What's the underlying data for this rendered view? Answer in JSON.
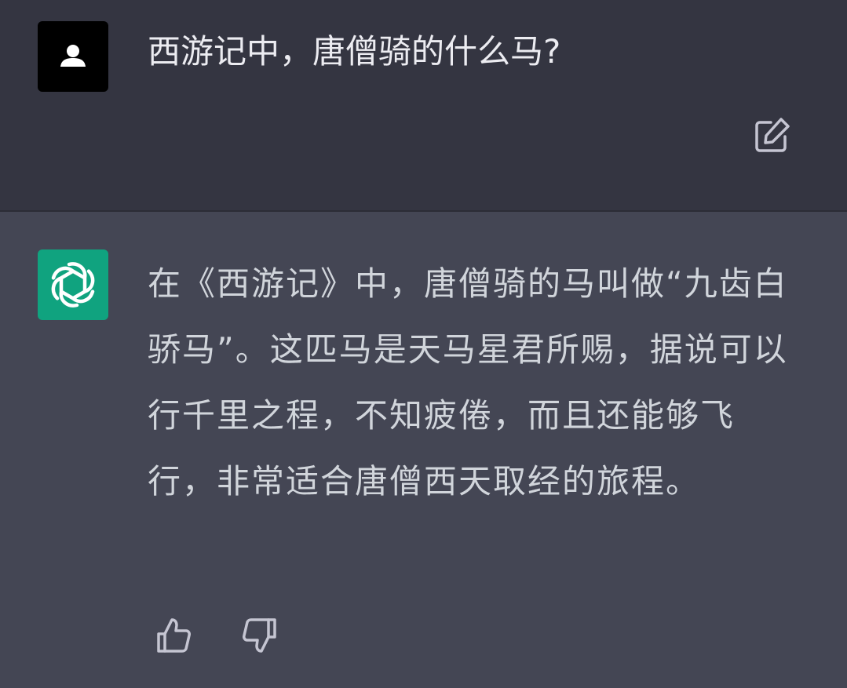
{
  "user_message": {
    "text": "西游记中，唐僧骑的什么马?"
  },
  "assistant_message": {
    "text": "在《西游记》中，唐僧骑的马叫做“九齿白骄马”。这匹马是天马星君所赐，据说可以行千里之程，不知疲倦，而且还能够飞行，非常适合唐僧西天取经的旅程。"
  },
  "icons": {
    "user_avatar": "user-silhouette-icon",
    "assistant_avatar": "openai-logo-icon",
    "edit": "edit-pencil-icon",
    "thumbs_up": "thumbs-up-icon",
    "thumbs_down": "thumbs-down-icon"
  },
  "colors": {
    "user_bg": "#343541",
    "assistant_bg": "#444654",
    "assistant_avatar_bg": "#10a37f",
    "user_avatar_bg": "#000000",
    "text": "#ececf1",
    "icon": "#c5c5d2"
  }
}
